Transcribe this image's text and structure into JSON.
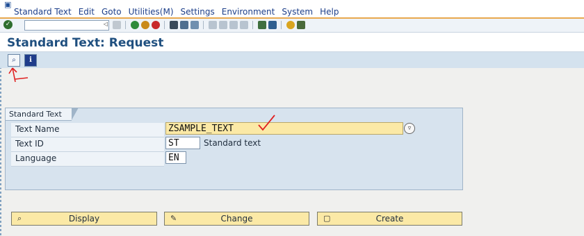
{
  "menu": {
    "items": [
      "Standard Text",
      "Edit",
      "Goto",
      "Utilities(M)",
      "Settings",
      "Environment",
      "System",
      "Help"
    ]
  },
  "toolbar": {
    "command_field_value": ""
  },
  "page": {
    "title": "Standard Text: Request"
  },
  "group": {
    "title": "Standard Text",
    "fields": [
      {
        "label": "Text Name",
        "value": "ZSAMPLE_TEXT"
      },
      {
        "label": "Text ID",
        "value": "ST",
        "description": "Standard text"
      },
      {
        "label": "Language",
        "value": "EN"
      }
    ]
  },
  "buttons": {
    "display_label": "Display",
    "change_label": "Change",
    "create_label": "Create"
  },
  "colors": {
    "title": "#1f4f7f",
    "menu_text": "#1d3f8a",
    "required_field": "#fbe9a6",
    "annotation": "#e02020",
    "menu_underline": "#e8a84e"
  },
  "icons": {
    "menu": "window-menu-icon",
    "enter": "enter-check-icon",
    "save": "save-icon",
    "back": "back-icon",
    "exit": "exit-icon",
    "cancel": "cancel-icon",
    "print": "print-icon",
    "find": "find-icon",
    "help": "help-icon",
    "layout": "layout-icon",
    "app_display": "display-object-icon",
    "app_info": "info-icon",
    "display": "glasses-icon",
    "change": "pencil-icon",
    "create": "new-document-icon",
    "f4": "f4-help-icon"
  }
}
